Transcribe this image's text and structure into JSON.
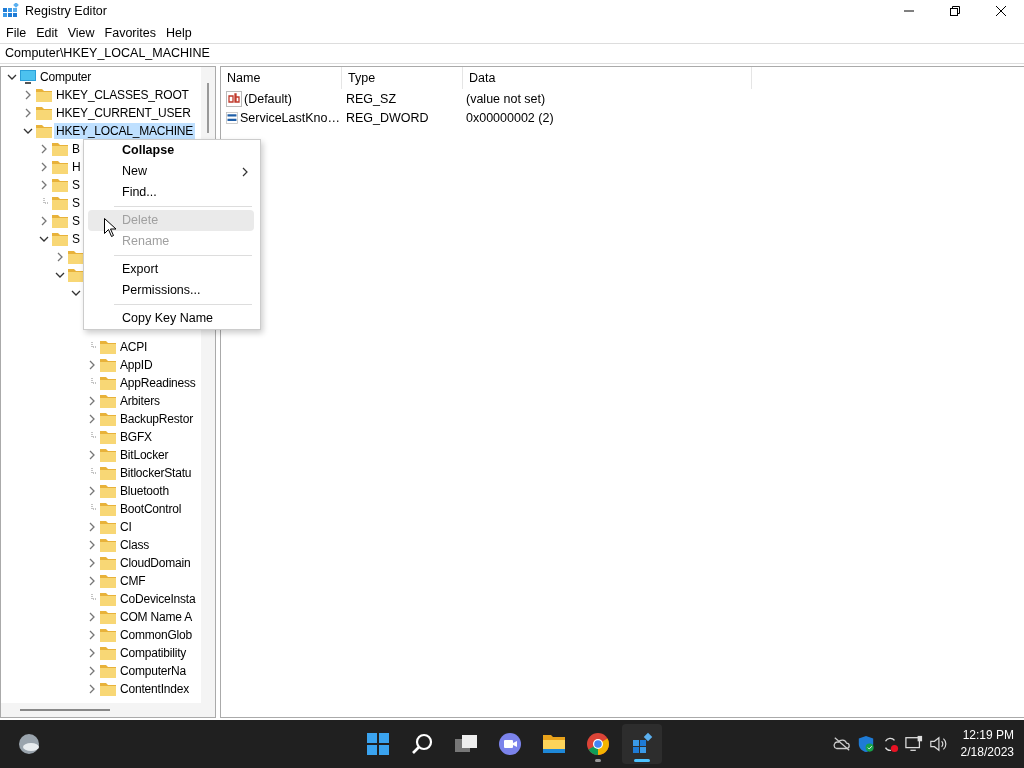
{
  "window": {
    "title": "Registry Editor"
  },
  "menu_bar": [
    "File",
    "Edit",
    "View",
    "Favorites",
    "Help"
  ],
  "address": "Computer\\HKEY_LOCAL_MACHINE",
  "tree": [
    {
      "label": "Computer",
      "kind": "computer",
      "expandable": true,
      "expanded": true,
      "selected": false,
      "children": [
        {
          "label": "HKEY_CLASSES_ROOT",
          "kind": "folder",
          "expandable": true,
          "expanded": false,
          "selected": false
        },
        {
          "label": "HKEY_CURRENT_USER",
          "kind": "folder",
          "expandable": true,
          "expanded": false,
          "selected": false
        },
        {
          "label": "HKEY_LOCAL_MACHINE",
          "kind": "folder",
          "expandable": true,
          "expanded": true,
          "selected": true,
          "children": [
            {
              "label": "B",
              "kind": "folder",
              "expandable": true,
              "expanded": false,
              "selected": false
            },
            {
              "label": "H",
              "kind": "folder",
              "expandable": true,
              "expanded": false,
              "selected": false
            },
            {
              "label": "S",
              "kind": "folder",
              "expandable": true,
              "expanded": false,
              "selected": false
            },
            {
              "label": "S",
              "kind": "folder",
              "expandable": false,
              "selected": false
            },
            {
              "label": "S",
              "kind": "folder",
              "expandable": true,
              "expanded": false,
              "selected": false
            },
            {
              "label": "S",
              "kind": "folder",
              "expandable": true,
              "expanded": true,
              "selected": false,
              "children": [
                {
                  "kind": "folder",
                  "expandable": true,
                  "expanded": false
                },
                {
                  "kind": "folder",
                  "expandable": true,
                  "expanded": true,
                  "children": [
                    {
                      "expandable": true,
                      "expanded": true,
                      "children": [
                        {
                          "label": "ACPI",
                          "kind": "folder",
                          "expandable": false,
                          "selected": false
                        },
                        {
                          "label": "AppID",
                          "kind": "folder",
                          "expandable": true,
                          "expanded": false,
                          "selected": false
                        },
                        {
                          "label": "AppReadiness",
                          "kind": "folder",
                          "expandable": false,
                          "selected": false
                        },
                        {
                          "label": "Arbiters",
                          "kind": "folder",
                          "expandable": true,
                          "expanded": false,
                          "selected": false
                        },
                        {
                          "label": "BackupRestor",
                          "kind": "folder",
                          "expandable": true,
                          "expanded": false,
                          "selected": false
                        },
                        {
                          "label": "BGFX",
                          "kind": "folder",
                          "expandable": false,
                          "selected": false
                        },
                        {
                          "label": "BitLocker",
                          "kind": "folder",
                          "expandable": true,
                          "expanded": false,
                          "selected": false
                        },
                        {
                          "label": "BitlockerStatu",
                          "kind": "folder",
                          "expandable": false,
                          "selected": false
                        },
                        {
                          "label": "Bluetooth",
                          "kind": "folder",
                          "expandable": true,
                          "expanded": false,
                          "selected": false
                        },
                        {
                          "label": "BootControl",
                          "kind": "folder",
                          "expandable": false,
                          "selected": false
                        },
                        {
                          "label": "CI",
                          "kind": "folder",
                          "expandable": true,
                          "expanded": false,
                          "selected": false
                        },
                        {
                          "label": "Class",
                          "kind": "folder",
                          "expandable": true,
                          "expanded": false,
                          "selected": false
                        },
                        {
                          "label": "CloudDomain",
                          "kind": "folder",
                          "expandable": true,
                          "expanded": false,
                          "selected": false
                        },
                        {
                          "label": "CMF",
                          "kind": "folder",
                          "expandable": true,
                          "expanded": false,
                          "selected": false
                        },
                        {
                          "label": "CoDeviceInsta",
                          "kind": "folder",
                          "expandable": false,
                          "selected": false
                        },
                        {
                          "label": "COM Name A",
                          "kind": "folder",
                          "expandable": true,
                          "expanded": false,
                          "selected": false
                        },
                        {
                          "label": "CommonGlob",
                          "kind": "folder",
                          "expandable": true,
                          "expanded": false,
                          "selected": false
                        },
                        {
                          "label": "Compatibility",
                          "kind": "folder",
                          "expandable": true,
                          "expanded": false,
                          "selected": false
                        },
                        {
                          "label": "ComputerNa",
                          "kind": "folder",
                          "expandable": true,
                          "expanded": false,
                          "selected": false
                        },
                        {
                          "label": "ContentIndex",
                          "kind": "folder",
                          "expandable": true,
                          "expanded": false,
                          "selected": false
                        }
                      ]
                    }
                  ]
                }
              ]
            }
          ]
        }
      ]
    }
  ],
  "values": {
    "columns": [
      "Name",
      "Type",
      "Data"
    ],
    "rows": [
      {
        "kind": "string",
        "name": "(Default)",
        "type": "REG_SZ",
        "data": "(value not set)"
      },
      {
        "kind": "dword",
        "name": "ServiceLastKno…",
        "type": "REG_DWORD",
        "data": "0x00000002 (2)"
      }
    ]
  },
  "context_menu": [
    {
      "kind": "item",
      "label": "Collapse",
      "bold": true,
      "disabled": false,
      "highlighted": false,
      "submenu": false
    },
    {
      "kind": "item",
      "label": "New",
      "bold": false,
      "disabled": false,
      "highlighted": false,
      "submenu": true
    },
    {
      "kind": "item",
      "label": "Find...",
      "bold": false,
      "disabled": false,
      "highlighted": false,
      "submenu": false
    },
    {
      "kind": "separator"
    },
    {
      "kind": "item",
      "label": "Delete",
      "bold": false,
      "disabled": true,
      "highlighted": true,
      "submenu": false
    },
    {
      "kind": "item",
      "label": "Rename",
      "bold": false,
      "disabled": true,
      "highlighted": false,
      "submenu": false
    },
    {
      "kind": "separator"
    },
    {
      "kind": "item",
      "label": "Export",
      "bold": false,
      "disabled": false,
      "highlighted": false,
      "submenu": false
    },
    {
      "kind": "item",
      "label": "Permissions...",
      "bold": false,
      "disabled": false,
      "highlighted": false,
      "submenu": false
    },
    {
      "kind": "separator"
    },
    {
      "kind": "item",
      "label": "Copy Key Name",
      "bold": false,
      "disabled": false,
      "highlighted": false,
      "submenu": false
    }
  ],
  "taskbar": {
    "apps": [
      {
        "kind": "start",
        "running": false,
        "active": false
      },
      {
        "kind": "search",
        "running": false,
        "active": false
      },
      {
        "kind": "taskview",
        "running": false,
        "active": false
      },
      {
        "kind": "chat",
        "running": false,
        "active": false
      },
      {
        "kind": "explorer",
        "running": false,
        "active": false
      },
      {
        "kind": "chrome",
        "running": true,
        "active": false
      },
      {
        "kind": "regedit",
        "running": true,
        "active": true
      }
    ],
    "tray": [
      {
        "kind": "cloud"
      },
      {
        "kind": "shield"
      },
      {
        "kind": "sync"
      },
      {
        "kind": "network"
      },
      {
        "kind": "volume"
      }
    ],
    "time": "12:19 PM",
    "date": "2/18/2023"
  }
}
